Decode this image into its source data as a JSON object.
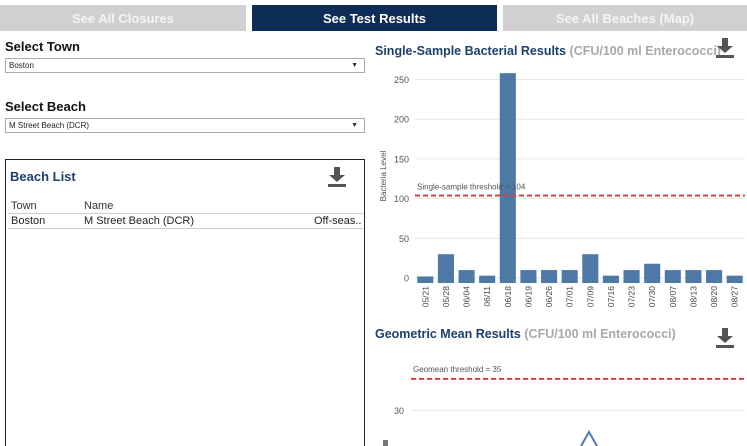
{
  "tabs": [
    {
      "label": "See All Closures",
      "active": false
    },
    {
      "label": "See Test Results",
      "active": true
    },
    {
      "label": "See All Beaches (Map)",
      "active": false
    }
  ],
  "filters": {
    "town_label": "Select Town",
    "town_value": "Boston",
    "beach_label": "Select Beach",
    "beach_value": "M Street Beach (DCR)"
  },
  "beach_list": {
    "title": "Beach List",
    "columns": [
      "Town",
      "Name"
    ],
    "rows": [
      {
        "town": "Boston",
        "name": "M Street Beach (DCR)",
        "status": "Off-seas.."
      }
    ]
  },
  "bacteria_chart": {
    "title": "Single-Sample Bacterial Results",
    "unit": "(CFU/100 ml Enterococci)"
  },
  "geomean_chart": {
    "title": "Geometric Mean Results",
    "unit": "(CFU/100 ml Enterococci)"
  },
  "colors": {
    "accent": "#0d2d57",
    "bar": "#4e79a7",
    "threshold": "#e03c3c",
    "tab_inactive": "#d0d0d0"
  },
  "icons": [
    "download-icon",
    "chevron-down-icon"
  ],
  "chart_data": [
    {
      "type": "bar",
      "title": "Single-Sample Bacterial Results (CFU/100 ml Enterococci)",
      "ylabel": "Bacteria Level",
      "xlabel": "",
      "categories": [
        "05/21",
        "05/28",
        "06/04",
        "06/11",
        "06/18",
        "06/19",
        "06/26",
        "07/01",
        "07/09",
        "07/16",
        "07/23",
        "07/30",
        "08/07",
        "08/13",
        "08/20",
        "08/27"
      ],
      "values": [
        2,
        30,
        10,
        3,
        258,
        10,
        10,
        10,
        30,
        3,
        10,
        18,
        10,
        10,
        10,
        3
      ],
      "ylim": [
        -5,
        262
      ],
      "yticks": [
        0,
        50,
        100,
        150,
        200,
        250
      ],
      "threshold": {
        "label": "Single-sample threshold = 104",
        "value": 104
      },
      "grid": true
    },
    {
      "type": "line",
      "title": "Geometric Mean Results (CFU/100 ml Enterococci)",
      "ylabel": "",
      "yticks": [
        30
      ],
      "ylim": [
        0,
        38
      ],
      "threshold": {
        "label": "Geomean threshold = 35",
        "value": 35
      },
      "grid": true
    }
  ]
}
